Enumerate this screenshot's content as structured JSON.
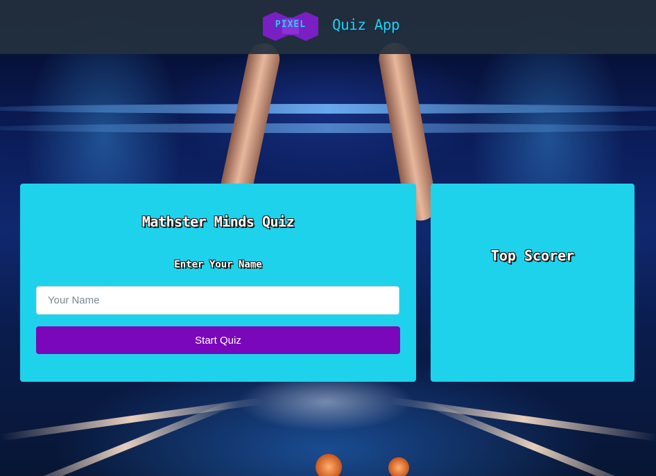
{
  "header": {
    "logo_text": "PIXEL",
    "app_title": "Quiz App"
  },
  "quiz": {
    "title": "Mathster Minds Quiz",
    "name_label": "Enter Your Name",
    "name_input": {
      "value": "",
      "placeholder": "Your Name"
    },
    "start_button_label": "Start Quiz"
  },
  "scorer": {
    "title": "Top Scorer"
  },
  "colors": {
    "header_bg": "#23303e",
    "card_bg": "#1ed2ec",
    "button_bg": "#7a07b9",
    "logo_purple": "#7a1fc4",
    "accent_cyan": "#1fd0ec"
  }
}
